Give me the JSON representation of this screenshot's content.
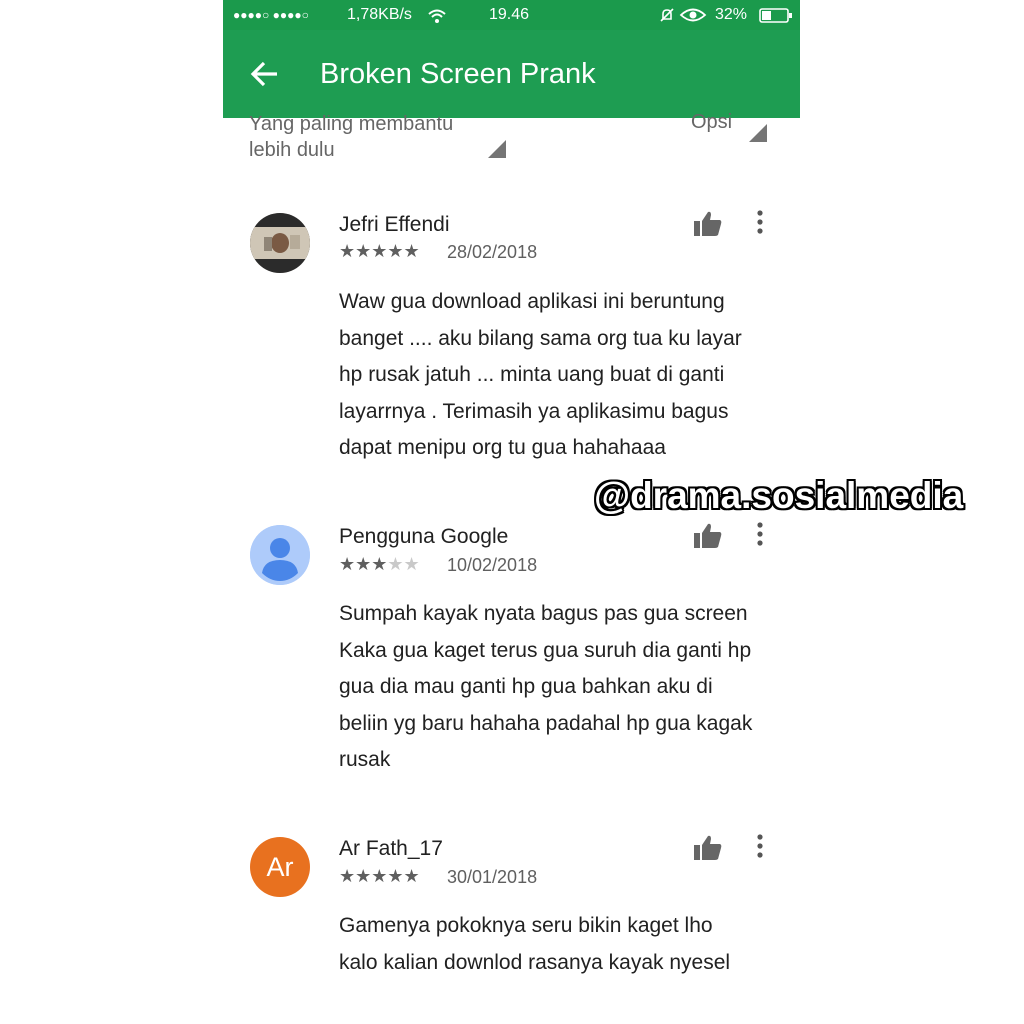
{
  "status_bar": {
    "signal": "●●●●○ ●●●●○",
    "speed": "1,78KB/s",
    "time": "19.46",
    "battery": "32%"
  },
  "toolbar": {
    "title": "Broken Screen Prank",
    "back_icon": "arrow-left-icon",
    "background": "#1e9d52"
  },
  "sort": {
    "label": "Yang paling membantu lebih dulu",
    "options_label": "Opsi"
  },
  "reviews": [
    {
      "author": "Jefri Effendi",
      "rating": 5,
      "stars": "★★★★★",
      "date": "28/02/2018",
      "lines": [
        "Waw gua download aplikasi ini beruntung",
        "banget .... aku bilang sama org tua ku layar",
        "hp rusak jatuh ... minta uang buat di ganti",
        "layarrnya . Terimasih ya aplikasimu bagus",
        "dapat menipu org tu gua hahahaaa"
      ]
    },
    {
      "author": "Pengguna Google",
      "rating": 3,
      "stars_filled": "★★★",
      "stars_empty": "★★",
      "date": "10/02/2018",
      "lines": [
        "Sumpah kayak nyata bagus pas gua screen",
        "Kaka gua kaget terus gua suruh dia ganti hp",
        "gua dia mau ganti hp gua bahkan aku di",
        "beliin yg baru hahaha padahal hp gua kagak",
        "rusak"
      ]
    },
    {
      "author": "Ar Fath_17",
      "avatar_initials": "Ar",
      "avatar_color": "#e8711f",
      "rating": 5,
      "stars": "★★★★★",
      "date": "30/01/2018",
      "lines": [
        "Gamenya pokoknya seru bikin kaget lho",
        "kalo kalian downlod rasanya kayak nyesel"
      ]
    }
  ],
  "watermark": "@drama.sosialmedia"
}
